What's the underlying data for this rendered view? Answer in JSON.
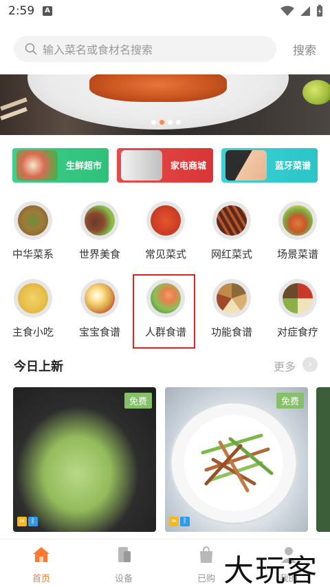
{
  "status": {
    "time": "2:59",
    "notif_letter": "A"
  },
  "search": {
    "placeholder": "输入菜名或食材名搜索",
    "button": "搜索"
  },
  "features": [
    {
      "label": "生鲜超市",
      "color": "#38cc84"
    },
    {
      "label": "家电商城",
      "color": "#e24242"
    },
    {
      "label": "蓝牙菜谱",
      "color": "#36cdd0"
    }
  ],
  "categories": [
    {
      "label": "中华菜系"
    },
    {
      "label": "世界美食"
    },
    {
      "label": "常见菜式"
    },
    {
      "label": "网红菜式"
    },
    {
      "label": "场景菜谱"
    },
    {
      "label": "主食小吃"
    },
    {
      "label": "宝宝食谱"
    },
    {
      "label": "人群食谱"
    },
    {
      "label": "功能食谱"
    },
    {
      "label": "对症食疗"
    }
  ],
  "section": {
    "title": "今日上新",
    "more": "更多"
  },
  "recipes": [
    {
      "badge": "免费"
    },
    {
      "badge": "免费"
    }
  ],
  "nav": [
    {
      "label": "首页",
      "active": true
    },
    {
      "label": "设备"
    },
    {
      "label": "已购"
    },
    {
      "label": "我的"
    }
  ],
  "watermark": "大玩客",
  "colors": {
    "accent": "#ff7a2e",
    "highlight": "#e02020",
    "badge": "#86c06a"
  }
}
